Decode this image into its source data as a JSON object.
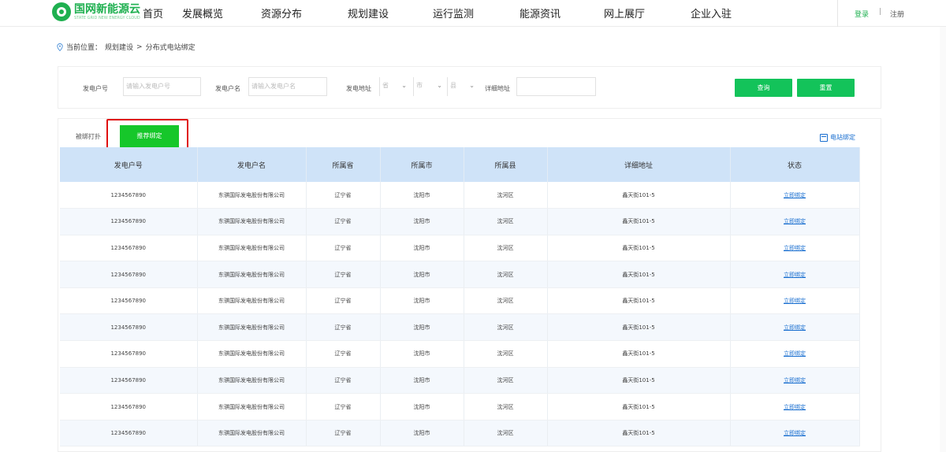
{
  "brand": {
    "name": "国网新能源云",
    "sub": "STATE GRID NEW ENERGY CLOUD",
    "accent": "#1fb050"
  },
  "nav": [
    "首页",
    "发展概览",
    "资源分布",
    "规划建设",
    "运行监测",
    "能源资讯",
    "网上展厅",
    "企业入驻"
  ],
  "auth": {
    "login": "登录",
    "sep": "|",
    "register": "注册"
  },
  "breadcrumb": {
    "prefix": "当前位置：",
    "level1": "规划建设",
    "arrow": ">",
    "level2": "分布式电站绑定"
  },
  "filter": {
    "generator_no_label": "发电户号",
    "generator_no_placeholder": "请输入发电户号",
    "generator_name_label": "发电户名",
    "generator_name_placeholder": "请输入发电户名",
    "address_label": "发电地址",
    "province": "省",
    "city": "市",
    "county": "县",
    "detail_label": "详细地址",
    "detail_value": "",
    "query_button": "查询",
    "reset_button": "重置"
  },
  "tabs": {
    "bound": "被绑打扑",
    "pending": "推荐绑定"
  },
  "bind_link": "电站绑定",
  "table": {
    "headers": [
      "发电户号",
      "发电户名",
      "所属省",
      "所属市",
      "所属县",
      "详细地址",
      "状态"
    ],
    "rows": [
      [
        "1234567890",
        "东骐国际发电股份有限公司",
        "辽宁省",
        "沈阳市",
        "沈河区",
        "鑫天街101-5",
        "立即绑定"
      ],
      [
        "1234567890",
        "东骐国际发电股份有限公司",
        "辽宁省",
        "沈阳市",
        "沈河区",
        "鑫天街101-5",
        "立即绑定"
      ],
      [
        "1234567890",
        "东骐国际发电股份有限公司",
        "辽宁省",
        "沈阳市",
        "沈河区",
        "鑫天街101-5",
        "立即绑定"
      ],
      [
        "1234567890",
        "东骐国际发电股份有限公司",
        "辽宁省",
        "沈阳市",
        "沈河区",
        "鑫天街101-5",
        "立即绑定"
      ],
      [
        "1234567890",
        "东骐国际发电股份有限公司",
        "辽宁省",
        "沈阳市",
        "沈河区",
        "鑫天街101-5",
        "立即绑定"
      ],
      [
        "1234567890",
        "东骐国际发电股份有限公司",
        "辽宁省",
        "沈阳市",
        "沈河区",
        "鑫天街101-5",
        "立即绑定"
      ],
      [
        "1234567890",
        "东骐国际发电股份有限公司",
        "辽宁省",
        "沈阳市",
        "沈河区",
        "鑫天街101-5",
        "立即绑定"
      ],
      [
        "1234567890",
        "东骐国际发电股份有限公司",
        "辽宁省",
        "沈阳市",
        "沈河区",
        "鑫天街101-5",
        "立即绑定"
      ],
      [
        "1234567890",
        "东骐国际发电股份有限公司",
        "辽宁省",
        "沈阳市",
        "沈河区",
        "鑫天街101-5",
        "立即绑定"
      ],
      [
        "1234567890",
        "东骐国际发电股份有限公司",
        "辽宁省",
        "沈阳市",
        "沈河区",
        "鑫天街101-5",
        "立即绑定"
      ]
    ]
  }
}
